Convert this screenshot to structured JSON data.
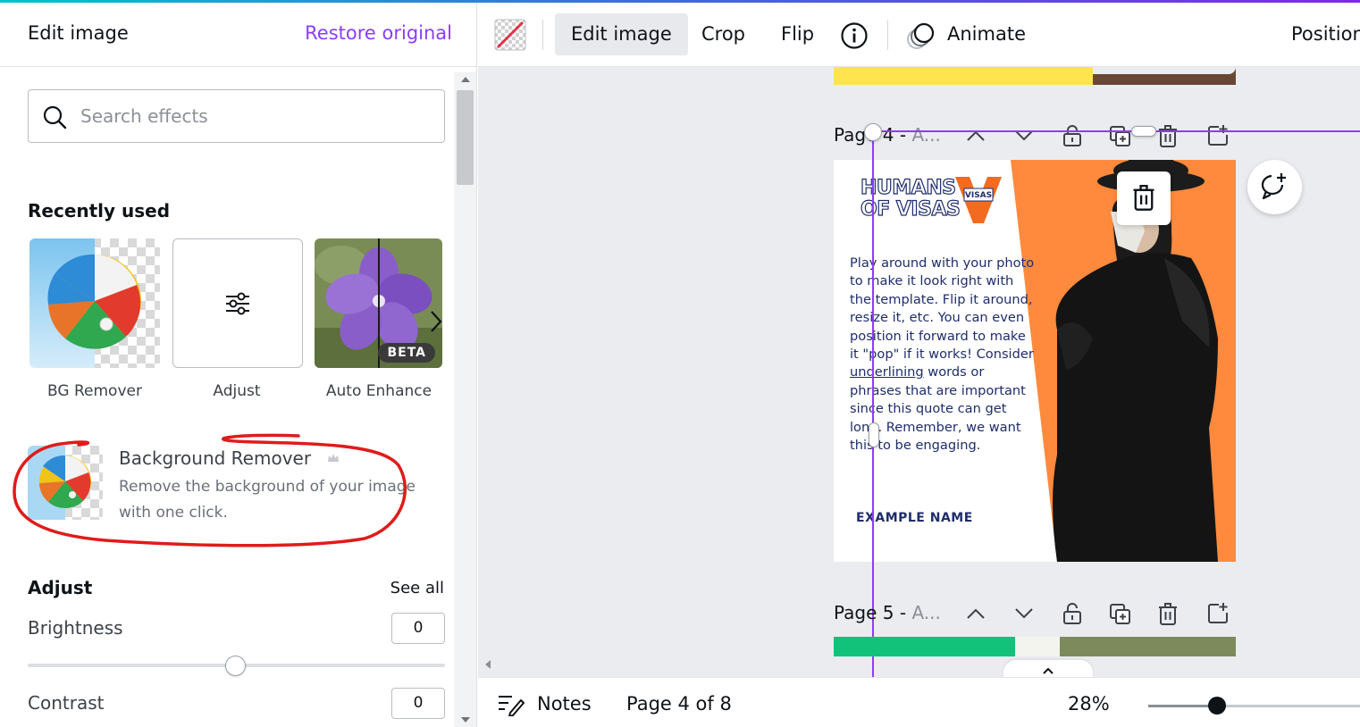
{
  "left_panel": {
    "title": "Edit image",
    "restore_label": "Restore original",
    "search": {
      "placeholder": "Search effects",
      "value": ""
    },
    "recently_used": {
      "heading": "Recently used",
      "items": [
        {
          "label": "BG Remover"
        },
        {
          "label": "Adjust"
        },
        {
          "label": "Auto Enhance",
          "badge": "BETA"
        }
      ]
    },
    "background_remover": {
      "title": "Background Remover",
      "description": "Remove the background of your image with one click."
    },
    "adjust": {
      "heading": "Adjust",
      "see_all": "See all",
      "brightness": {
        "label": "Brightness",
        "value": "0"
      },
      "contrast": {
        "label": "Contrast",
        "value": "0"
      }
    }
  },
  "toolbar": {
    "edit_image": "Edit image",
    "crop": "Crop",
    "flip": "Flip",
    "animate": "Animate",
    "position": "Position"
  },
  "canvas": {
    "page4": {
      "label_main": "Page 4 - ",
      "label_dim": "A...",
      "logo_line1": "HUMANS",
      "logo_line2": "OF VISAS",
      "logo_badge": "VISAS",
      "body_before": "Play around with your photo to make it look right with the template. Flip it around, resize it, etc. You can even position it forward to make it \"pop\" if it works! Consider ",
      "body_underlined": "underlining",
      "body_after": " words or phrases that are important since this quote can get long. Remember, we want this to be engaging.",
      "name": "EXAMPLE NAME"
    },
    "page5": {
      "label_main": "Page 5 - ",
      "label_dim": "A..."
    }
  },
  "bottom_bar": {
    "notes": "Notes",
    "page_indicator": "Page 4 of 8",
    "zoom": "28%"
  },
  "colors": {
    "accent": "#8b3dff",
    "brand_navy": "#1f2d6b",
    "brand_orange": "#ff8a3d",
    "annotation_red": "#e01b1b"
  },
  "icons": [
    "search-icon",
    "adjust-sliders-icon",
    "chevron-right-icon",
    "crown-icon",
    "transparency-icon",
    "info-icon",
    "animate-icon",
    "chevron-up-icon",
    "chevron-down-icon",
    "lock-icon",
    "duplicate-icon",
    "trash-icon",
    "add-page-icon",
    "comment-add-icon",
    "notes-icon"
  ]
}
